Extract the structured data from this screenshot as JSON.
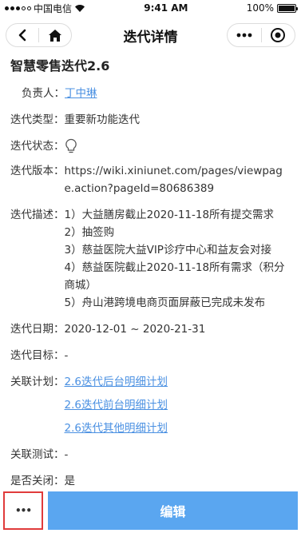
{
  "status_bar": {
    "carrier": "中国电信",
    "time": "9:41 AM",
    "battery": "100%",
    "battery_level": 1.0
  },
  "nav": {
    "title": "迭代详情"
  },
  "detail": {
    "title": "智慧零售迭代2.6",
    "owner_label": "负责人：",
    "owner_value": "丁中琳",
    "type_label": "迭代类型：",
    "type_value": "重要新功能迭代",
    "status_label": "迭代状态：",
    "status_icon": "lightbulb-icon",
    "version_label": "迭代版本：",
    "version_value": "https://wiki.xiniunet.com/pages/viewpage.action?pageId=80686389",
    "desc_label": "迭代描述：",
    "desc_lines": [
      "1）大益膳房截止2020-11-18所有提交需求",
      "2）抽签购",
      "3）慈益医院大益VIP诊疗中心和益友会对接",
      "4）慈益医院截止2020-11-18所有需求（积分商城）",
      "5）舟山港跨境电商页面屏蔽已完成未发布"
    ],
    "date_label": "迭代日期：",
    "date_value": "2020-12-01 ~ 2020-21-31",
    "goal_label": "迭代目标：",
    "goal_value": "-",
    "plan_label": "关联计划：",
    "plans": [
      "2.6迭代后台明细计划",
      "2.6迭代前台明细计划",
      "2.6迭代其他明细计划"
    ],
    "test_label": "关联测试：",
    "test_value": "-",
    "closed_label": "是否关闭：",
    "closed_value": "是"
  },
  "bottom": {
    "more_label": "•••",
    "edit_label": "编辑"
  }
}
